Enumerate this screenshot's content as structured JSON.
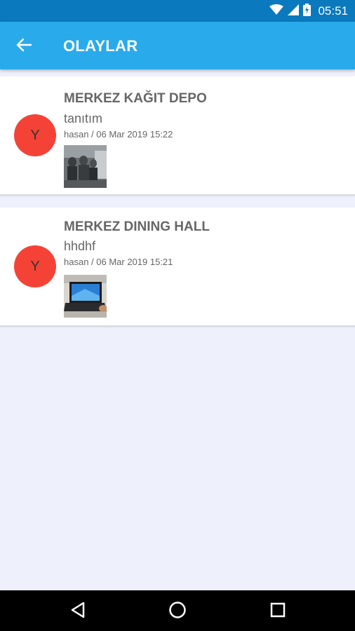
{
  "status_bar": {
    "time": "05:51",
    "icons": [
      "wifi-icon",
      "signal-icon",
      "battery-icon"
    ]
  },
  "app_bar": {
    "title": "OLAYLAR",
    "back_icon": "arrow-left-icon",
    "color": "#29aaea"
  },
  "events": [
    {
      "avatar_letter": "Y",
      "title": "MERKEZ KAĞIT DEPO",
      "description": "tanıtım",
      "meta": "hasan / 06 Mar 2019 15:22",
      "thumbnail": "photo-people-thumbnail"
    },
    {
      "avatar_letter": "Y",
      "title": "MERKEZ DINING HALL",
      "description": "hhdhf",
      "meta": "hasan / 06 Mar 2019 15:21",
      "thumbnail": "photo-laptop-thumbnail"
    }
  ],
  "nav_bar": {
    "icons": [
      "back-triangle-icon",
      "home-circle-icon",
      "recents-square-icon"
    ]
  },
  "colors": {
    "status_bar": "#0a79bd",
    "avatar": "#f44336",
    "background": "#eef1fb"
  }
}
